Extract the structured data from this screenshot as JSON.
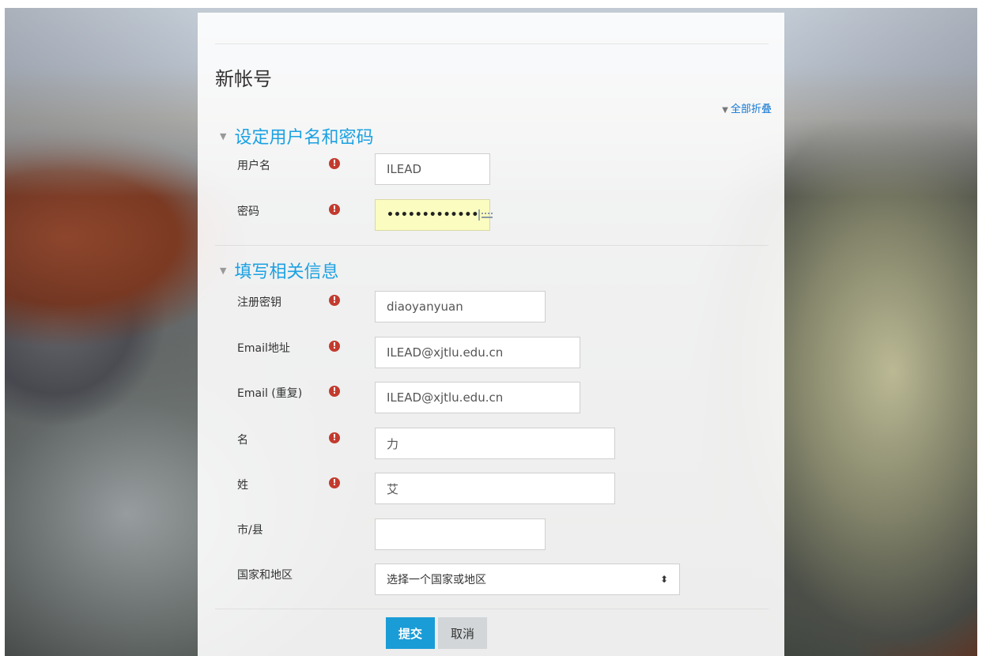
{
  "page": {
    "title": "新帐号",
    "collapse_all": "全部折叠"
  },
  "sections": [
    {
      "title": "设定用户名和密码"
    },
    {
      "title": "填写相关信息"
    }
  ],
  "fields": {
    "username": {
      "label": "用户名",
      "value": "ILEAD",
      "required": true
    },
    "password": {
      "label": "密码",
      "value": "•••••••••••••",
      "required": true
    },
    "enrolment_key": {
      "label": "注册密钥",
      "value": "diaoyanyuan",
      "required": true
    },
    "email": {
      "label": "Email地址",
      "value": "ILEAD@xjtlu.edu.cn",
      "required": true
    },
    "email_repeat": {
      "label": "Email (重复)",
      "value": "ILEAD@xjtlu.edu.cn",
      "required": true
    },
    "firstname": {
      "label": "名",
      "value": "力",
      "required": true
    },
    "lastname": {
      "label": "姓",
      "value": "艾",
      "required": true
    },
    "city": {
      "label": "市/县",
      "value": "",
      "required": false
    },
    "country": {
      "label": "国家和地区",
      "selected": "选择一个国家或地区",
      "required": false
    }
  },
  "required_mark": "!",
  "buttons": {
    "submit": "提交",
    "cancel": "取消"
  },
  "icons": {
    "required": "exclamation-circle-icon",
    "password_keyboard": "keyboard-icon",
    "collapse_triangle": "triangle-down-icon",
    "select_arrows": "up-down-arrows-icon"
  },
  "colors": {
    "section_heading": "#1ba1e2",
    "required_icon": "#c23b2e",
    "primary_button": "#1a9cd7",
    "secondary_button": "#d2d6d9",
    "link": "#1177d1",
    "password_autofill": "#fafdbf"
  }
}
